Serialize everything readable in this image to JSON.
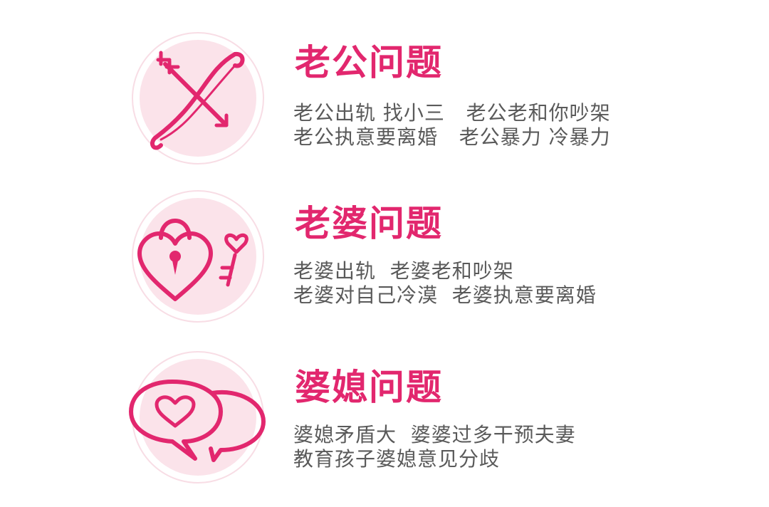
{
  "colors": {
    "accent": "#e2276e",
    "circle_fill": "#fbe3ea",
    "circle_ring": "#f8dde5",
    "body_text": "#5a5a5a"
  },
  "sections": [
    {
      "icon": "bow-and-arrow-icon",
      "title": "老公问题",
      "lines": [
        "老公出轨 找小三   老公老和你吵架",
        "老公执意要离婚   老公暴力 冷暴力"
      ]
    },
    {
      "icon": "heart-lock-and-key-icon",
      "title": "老婆问题",
      "lines": [
        "老婆出轨  老婆老和吵架",
        "老婆对自己冷漠  老婆执意要离婚"
      ]
    },
    {
      "icon": "speech-bubbles-heart-icon",
      "title": "婆媳问题",
      "lines": [
        "婆媳矛盾大  婆婆过多干预夫妻",
        "教育孩子婆媳意见分歧"
      ]
    }
  ]
}
